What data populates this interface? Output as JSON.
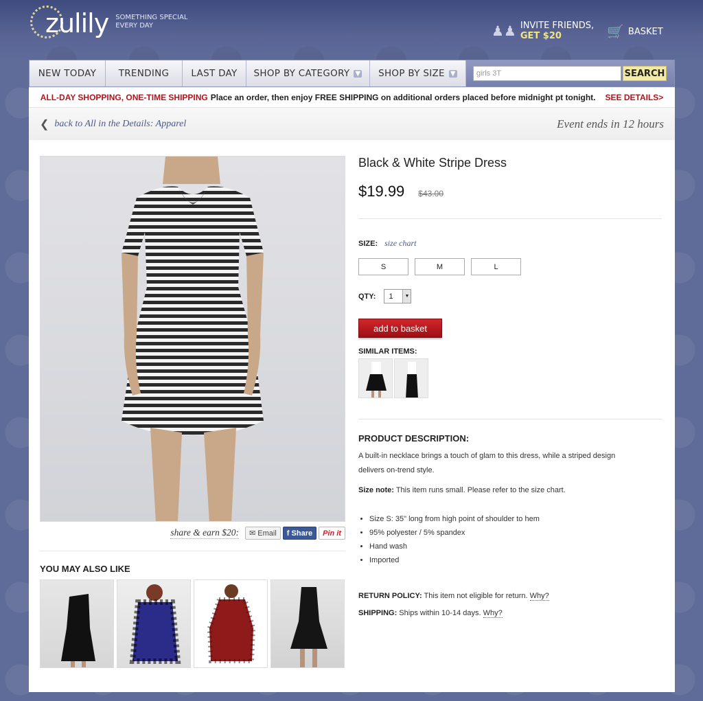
{
  "brand": {
    "name": "zulily",
    "tagline_line1": "SOMETHING SPECIAL",
    "tagline_line2": "EVERY DAY"
  },
  "header": {
    "invite_line1": "INVITE FRIENDS,",
    "invite_line2": "GET $20",
    "basket_label": "BASKET"
  },
  "nav": {
    "items": [
      {
        "label": "NEW TODAY"
      },
      {
        "label": "TRENDING"
      },
      {
        "label": "LAST DAY"
      },
      {
        "label": "SHOP BY CATEGORY"
      },
      {
        "label": "SHOP BY SIZE"
      }
    ],
    "search_value": "girls 3T",
    "search_button": "SEARCH"
  },
  "promo": {
    "highlight": "ALL-DAY SHOPPING, ONE-TIME SHIPPING",
    "text": "Place an order, then enjoy FREE SHIPPING on additional orders placed before midnight pt tonight.",
    "details": "SEE DETAILS>"
  },
  "breadcrumb": {
    "back_label": "back to All in the Details: Apparel",
    "event": "Event ends in 12 hours"
  },
  "product": {
    "title": "Black & White Stripe Dress",
    "price": "$19.99",
    "original_price": "$43.00",
    "size_label": "SIZE:",
    "size_chart": "size chart",
    "sizes": [
      "S",
      "M",
      "L"
    ],
    "qty_label": "QTY:",
    "qty_value": "1",
    "add_button": "add to basket",
    "similar_label": "SIMILAR ITEMS:",
    "desc_title": "PRODUCT DESCRIPTION:",
    "description": "A built-in necklace brings a touch of glam to this dress, while a striped design delivers on-trend style.",
    "size_note_label": "Size note:",
    "size_note": "This item runs small. Please refer to the size chart.",
    "bullets": [
      "Size S: 35\" long from high point of shoulder to hem",
      "95% polyester / 5% spandex",
      "Hand wash",
      "Imported"
    ],
    "return_label": "RETURN POLICY:",
    "return_text": "This item not eligible for return.",
    "shipping_label": "SHIPPING:",
    "shipping_text": "Ships within 10-14 days.",
    "why": "Why?"
  },
  "share": {
    "label": "share & earn $20:",
    "email": "Email",
    "facebook": "Share",
    "pinterest": "Pin it"
  },
  "ymal_title": "YOU MAY ALSO LIKE",
  "colors": {
    "accent_red": "#b3151b",
    "link_blue": "#48598e",
    "search_yellow": "#f3eaa6"
  }
}
